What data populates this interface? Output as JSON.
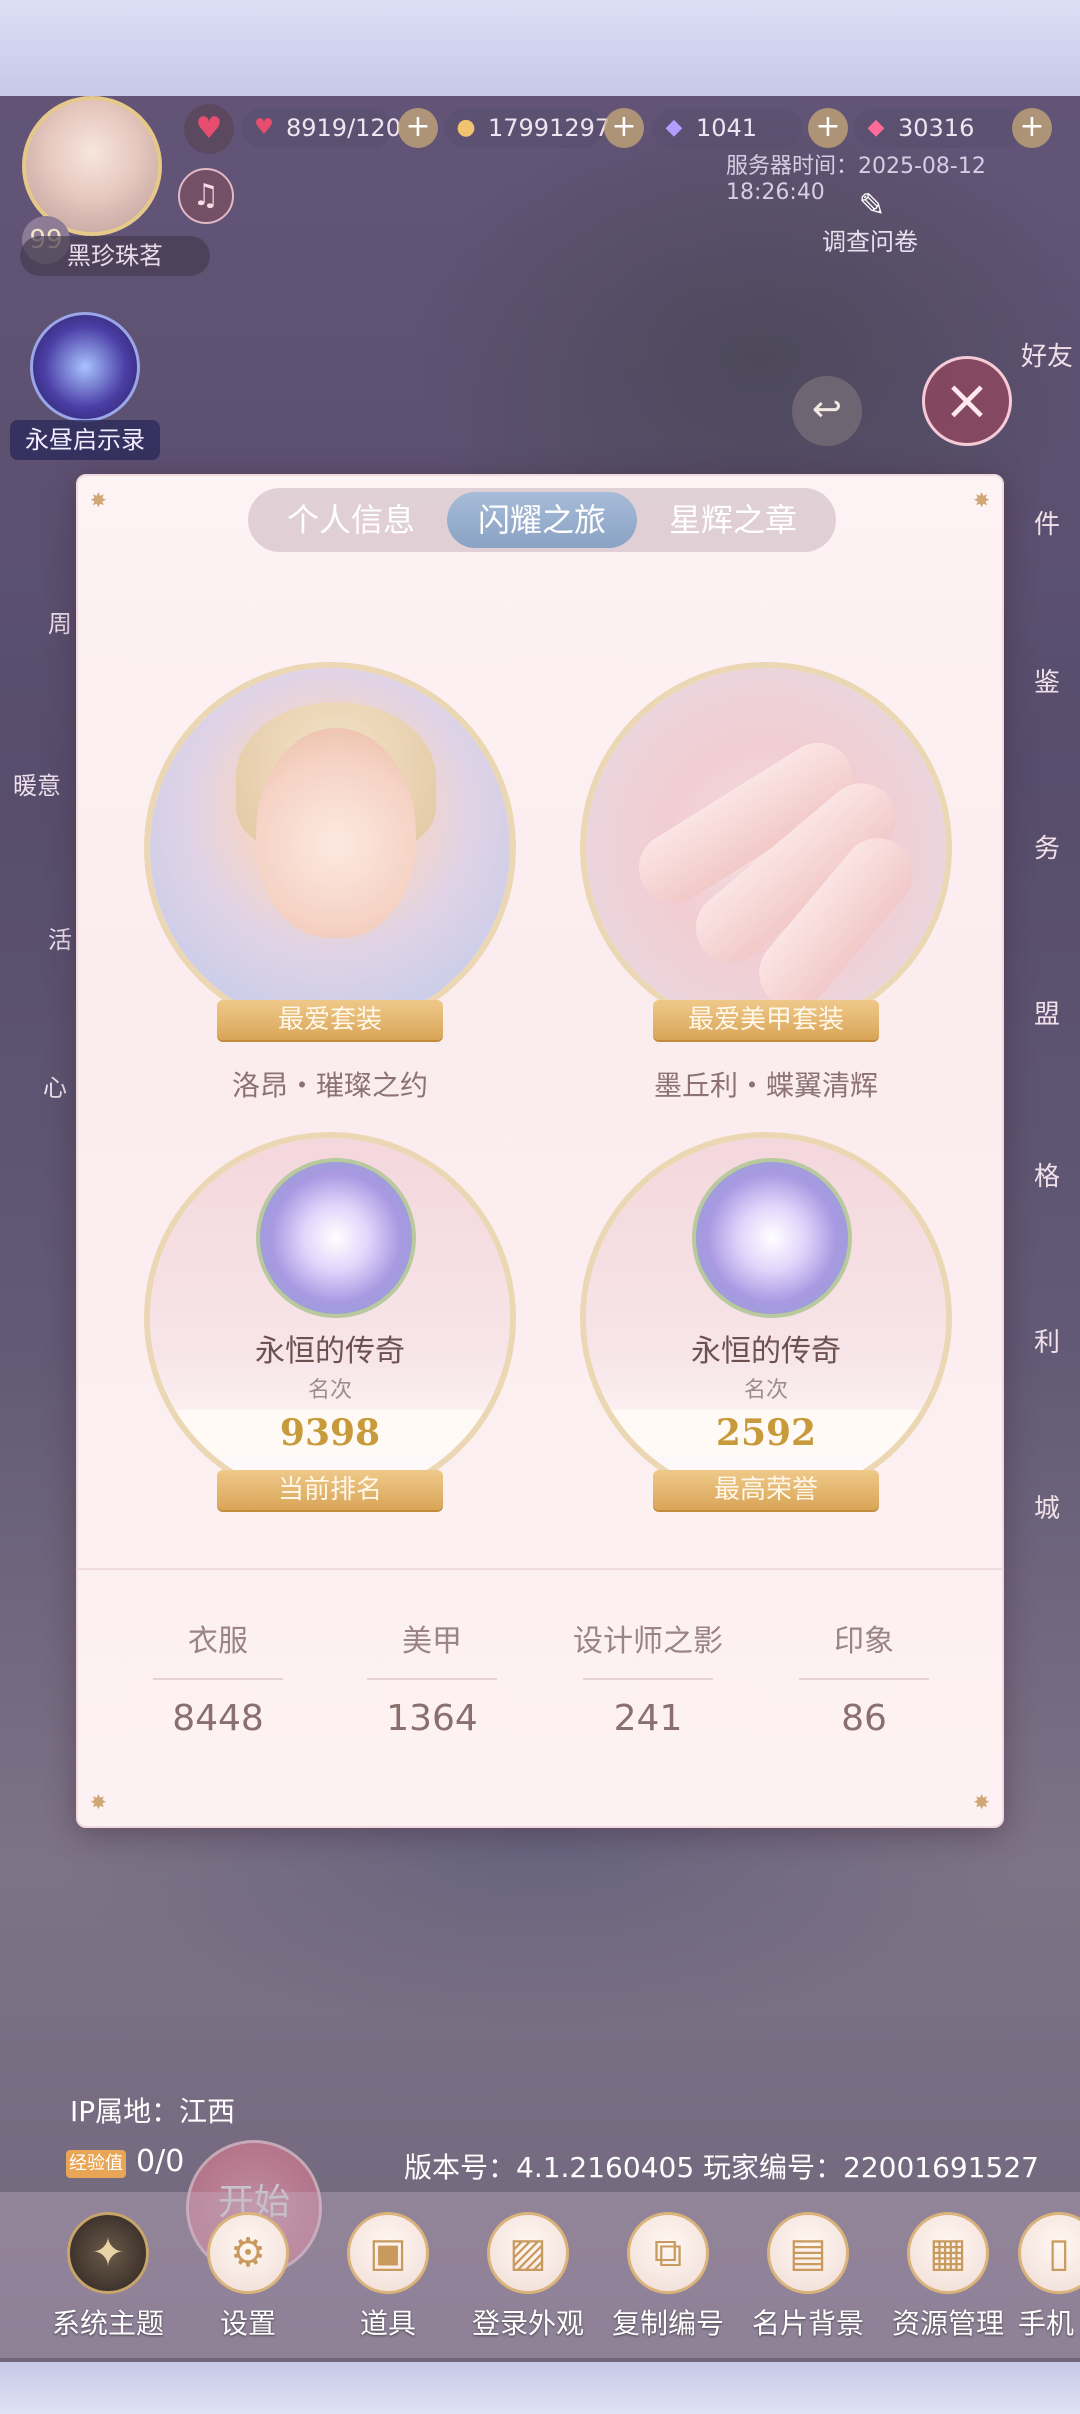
{
  "header": {
    "level": "99",
    "player_name": "黑珍珠茗",
    "stamina": "8919/120",
    "gold": "17991297",
    "crystal": "1041",
    "diamond": "30316",
    "server_time": "服务器时间：2025-08-12 18:26:40",
    "survey": "调查问卷"
  },
  "left_rail": {
    "orb_label": "永昼启示录",
    "items": [
      "周",
      "暖意",
      "活",
      "心"
    ]
  },
  "right_rail": [
    "好友",
    "件",
    "鉴",
    "务",
    "盟",
    "格",
    "利",
    "城"
  ],
  "modal": {
    "tabs": [
      "个人信息",
      "闪耀之旅",
      "星辉之章"
    ],
    "active_tab": 1,
    "favorite_outfit": {
      "ribbon": "最爱套装",
      "name": "洛昂・璀璨之约"
    },
    "favorite_nail": {
      "ribbon": "最爱美甲套装",
      "name": "墨丘利・蝶翼清辉"
    },
    "current_rank": {
      "title": "永恒的传奇",
      "sub": "名次",
      "value": "9398",
      "ribbon": "当前排名"
    },
    "best_honor": {
      "title": "永恒的传奇",
      "sub": "名次",
      "value": "2592",
      "ribbon": "最高荣誉"
    },
    "stats": [
      {
        "label": "衣服",
        "value": "8448"
      },
      {
        "label": "美甲",
        "value": "1364"
      },
      {
        "label": "设计师之影",
        "value": "241"
      },
      {
        "label": "印象",
        "value": "86"
      }
    ]
  },
  "footer": {
    "ip": "IP属地：江西",
    "exp_badge": "经验值",
    "exp_value": "0/0",
    "version": "版本号：4.1.2160405  玩家编号：22001691527",
    "start": "开始"
  },
  "dock": [
    {
      "label": "系统主题",
      "icon": "theme-icon"
    },
    {
      "label": "设置",
      "icon": "gear-icon"
    },
    {
      "label": "道具",
      "icon": "gift-icon"
    },
    {
      "label": "登录外观",
      "icon": "image-icon"
    },
    {
      "label": "复制编号",
      "icon": "copy-icon"
    },
    {
      "label": "名片背景",
      "icon": "card-icon"
    },
    {
      "label": "资源管理",
      "icon": "folder-icon"
    },
    {
      "label": "手机",
      "icon": "phone-icon"
    }
  ]
}
